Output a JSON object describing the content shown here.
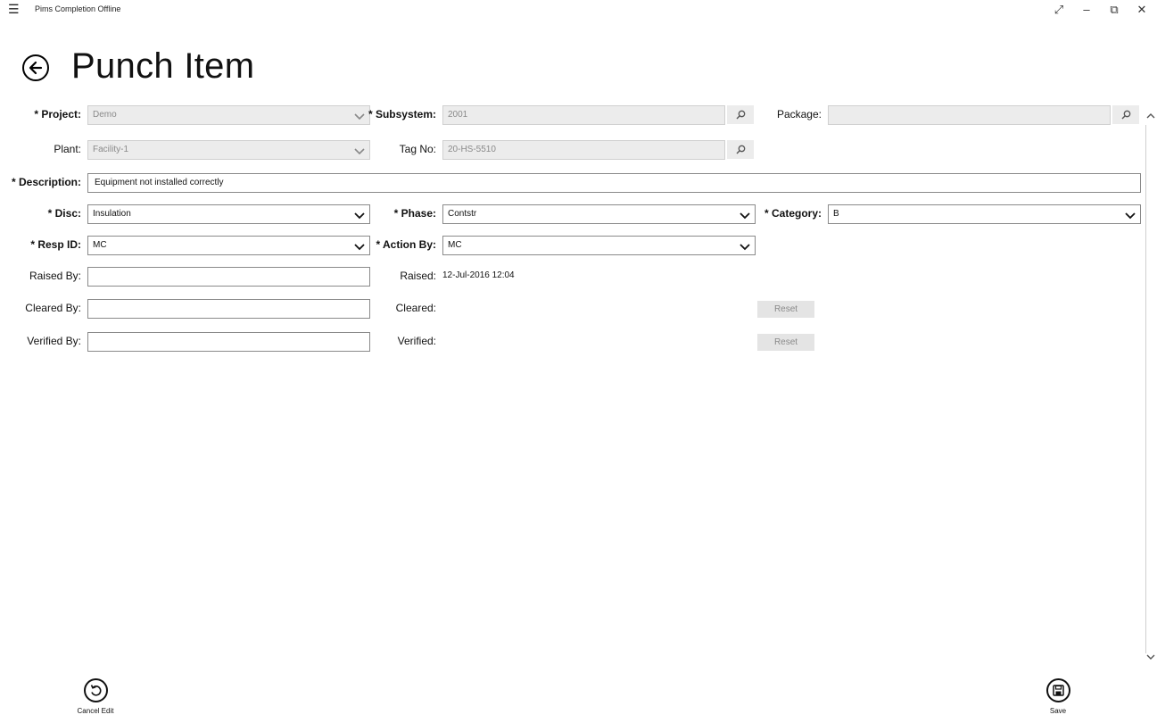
{
  "window": {
    "title": "Pims Completion Offline",
    "menu_icon": "hamburger-icon",
    "controls": [
      "fullscreen-icon",
      "minimize-icon",
      "restore-icon",
      "close-icon"
    ]
  },
  "page": {
    "title": "Punch Item",
    "back_icon": "back-arrow-icon"
  },
  "form": {
    "project": {
      "label": "* Project:",
      "value": "Demo"
    },
    "subsystem": {
      "label": "* Subsystem:",
      "value": "2001"
    },
    "package": {
      "label": "Package:",
      "value": ""
    },
    "plant": {
      "label": "Plant:",
      "value": "Facility-1"
    },
    "tag_no": {
      "label": "Tag No:",
      "value": "20-HS-5510"
    },
    "description": {
      "label": "* Description:",
      "value": "Equipment not installed correctly"
    },
    "disc": {
      "label": "* Disc:",
      "value": "Insulation"
    },
    "phase": {
      "label": "* Phase:",
      "value": "Contstr"
    },
    "category": {
      "label": "* Category:",
      "value": "B"
    },
    "resp_id": {
      "label": "* Resp ID:",
      "value": "MC"
    },
    "action_by": {
      "label": "* Action By:",
      "value": "MC"
    },
    "raised_by": {
      "label": "Raised By:",
      "value": ""
    },
    "raised": {
      "label": "Raised:",
      "value": "12-Jul-2016 12:04"
    },
    "cleared_by": {
      "label": "Cleared By:",
      "value": ""
    },
    "cleared": {
      "label": "Cleared:",
      "value": "",
      "reset_label": "Reset"
    },
    "verified_by": {
      "label": "Verified By:",
      "value": ""
    },
    "verified": {
      "label": "Verified:",
      "value": "",
      "reset_label": "Reset"
    }
  },
  "appbar": {
    "cancel_edit": {
      "label": "Cancel Edit",
      "icon": "undo-icon"
    },
    "save": {
      "label": "Save",
      "icon": "save-icon"
    }
  },
  "colors": {
    "disabled_field_bg": "#ececec",
    "field_border": "#8a8a8a",
    "disabled_text": "#8a8a8a"
  }
}
